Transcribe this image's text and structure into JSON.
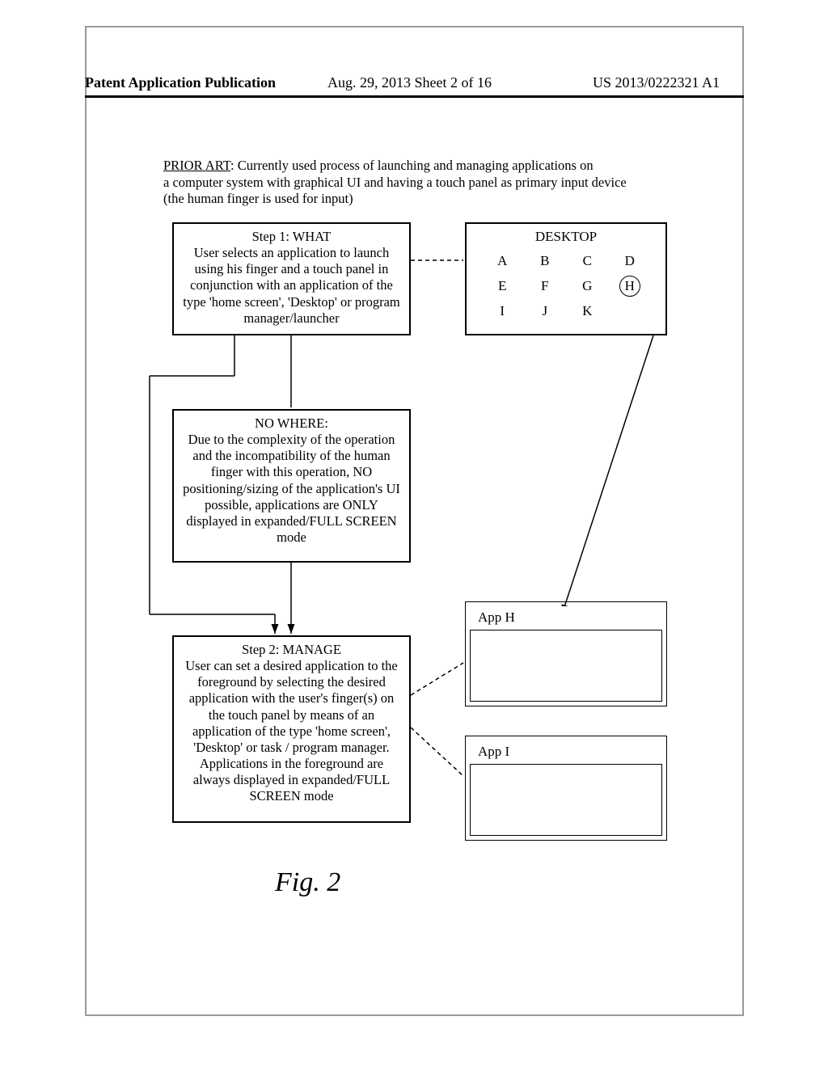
{
  "header": {
    "left": "Patent Application Publication",
    "center": "Aug. 29, 2013  Sheet 2 of 16",
    "right": "US 2013/0222321 A1"
  },
  "intro": {
    "prior_label": "PRIOR ART",
    "text_line1": ": Currently used process of launching and managing applications on",
    "text_line2": "a computer system with graphical UI and having a touch panel as primary input device",
    "text_line3": "(the human finger is used for input)"
  },
  "flow": {
    "step1": {
      "title": "Step 1: WHAT",
      "body": "User selects an application to launch using his finger and a touch panel in conjunction with an application of the type 'home screen', 'Desktop' or program manager/launcher"
    },
    "nowhere": {
      "title": "NO WHERE:",
      "body": "Due to the complexity of the operation and the incompatibility of the human finger with this operation, NO positioning/sizing of the application's UI possible, applications are ONLY displayed in expanded/FULL SCREEN mode"
    },
    "step2": {
      "title": "Step 2: MANAGE",
      "body": "User can set a desired application to the foreground by selecting the desired application with the user's finger(s) on the touch panel by means of an application of the type 'home screen', 'Desktop' or task / program manager. Applications in the foreground are always displayed in expanded/FULL SCREEN mode"
    }
  },
  "desktop": {
    "title": "DESKTOP",
    "icons": [
      "A",
      "B",
      "C",
      "D",
      "E",
      "F",
      "G",
      "H",
      "I",
      "J",
      "K",
      ""
    ],
    "circled_index": 7
  },
  "apps": {
    "appH": "App H",
    "appI": "App I"
  },
  "figure_label": "Fig. 2"
}
